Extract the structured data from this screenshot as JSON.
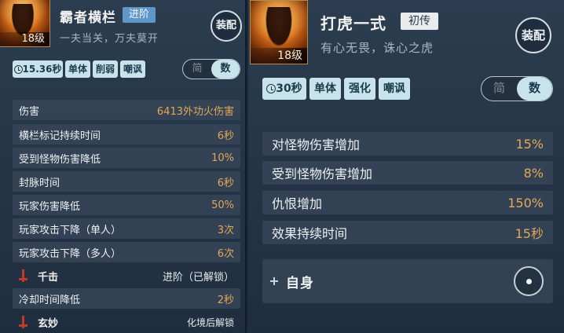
{
  "left": {
    "level": "18级",
    "title": "霸者横栏",
    "rank": "进阶",
    "motto": "一夫当关，万夫莫开",
    "equip_label": "装配",
    "tags": {
      "cooldown": "15.36秒",
      "t1": "单体",
      "t2": "削弱",
      "t3": "嘲讽"
    },
    "toggle": {
      "simple": "简",
      "numbers": "数"
    },
    "stats": [
      {
        "label": "伤害",
        "value": "6413外功火伤害"
      },
      {
        "label": "横栏标记持续时间",
        "value": "6秒"
      },
      {
        "label": "受到怪物伤害降低",
        "value": "10%"
      },
      {
        "label": "封脉时间",
        "value": "6秒"
      },
      {
        "label": "玩家伤害降低",
        "value": "50%"
      },
      {
        "label": "玩家攻击下降（单人）",
        "value": "3次"
      },
      {
        "label": "玩家攻击下降（多人）",
        "value": "6次"
      }
    ],
    "upgrade1": {
      "label": "千击",
      "state": "进阶（已解锁）"
    },
    "stat8": {
      "label": "冷却时间降低",
      "value": "2秒"
    },
    "upgrade2": {
      "label": "玄妙",
      "state": "化境后解锁"
    }
  },
  "right": {
    "level": "18级",
    "title": "打虎一式",
    "rank": "初传",
    "motto": "有心无畏，诛心之虎",
    "equip_label": "装配",
    "tags": {
      "cooldown": "30秒",
      "t1": "单体",
      "t2": "强化",
      "t3": "嘲讽"
    },
    "toggle": {
      "simple": "简",
      "numbers": "数"
    },
    "stats": [
      {
        "label": "对怪物伤害增加",
        "value": "15%"
      },
      {
        "label": "受到怪物伤害增加",
        "value": "8%"
      },
      {
        "label": "仇恨增加",
        "value": "150%"
      },
      {
        "label": "效果持续时间",
        "value": "15秒"
      }
    ],
    "target": "自身"
  },
  "colors": {
    "badge_advanced": "#5f97c6",
    "badge_initial": "#e9ecee",
    "value_gold": "#e4a756",
    "tag_bg": "#c9e3ec"
  }
}
